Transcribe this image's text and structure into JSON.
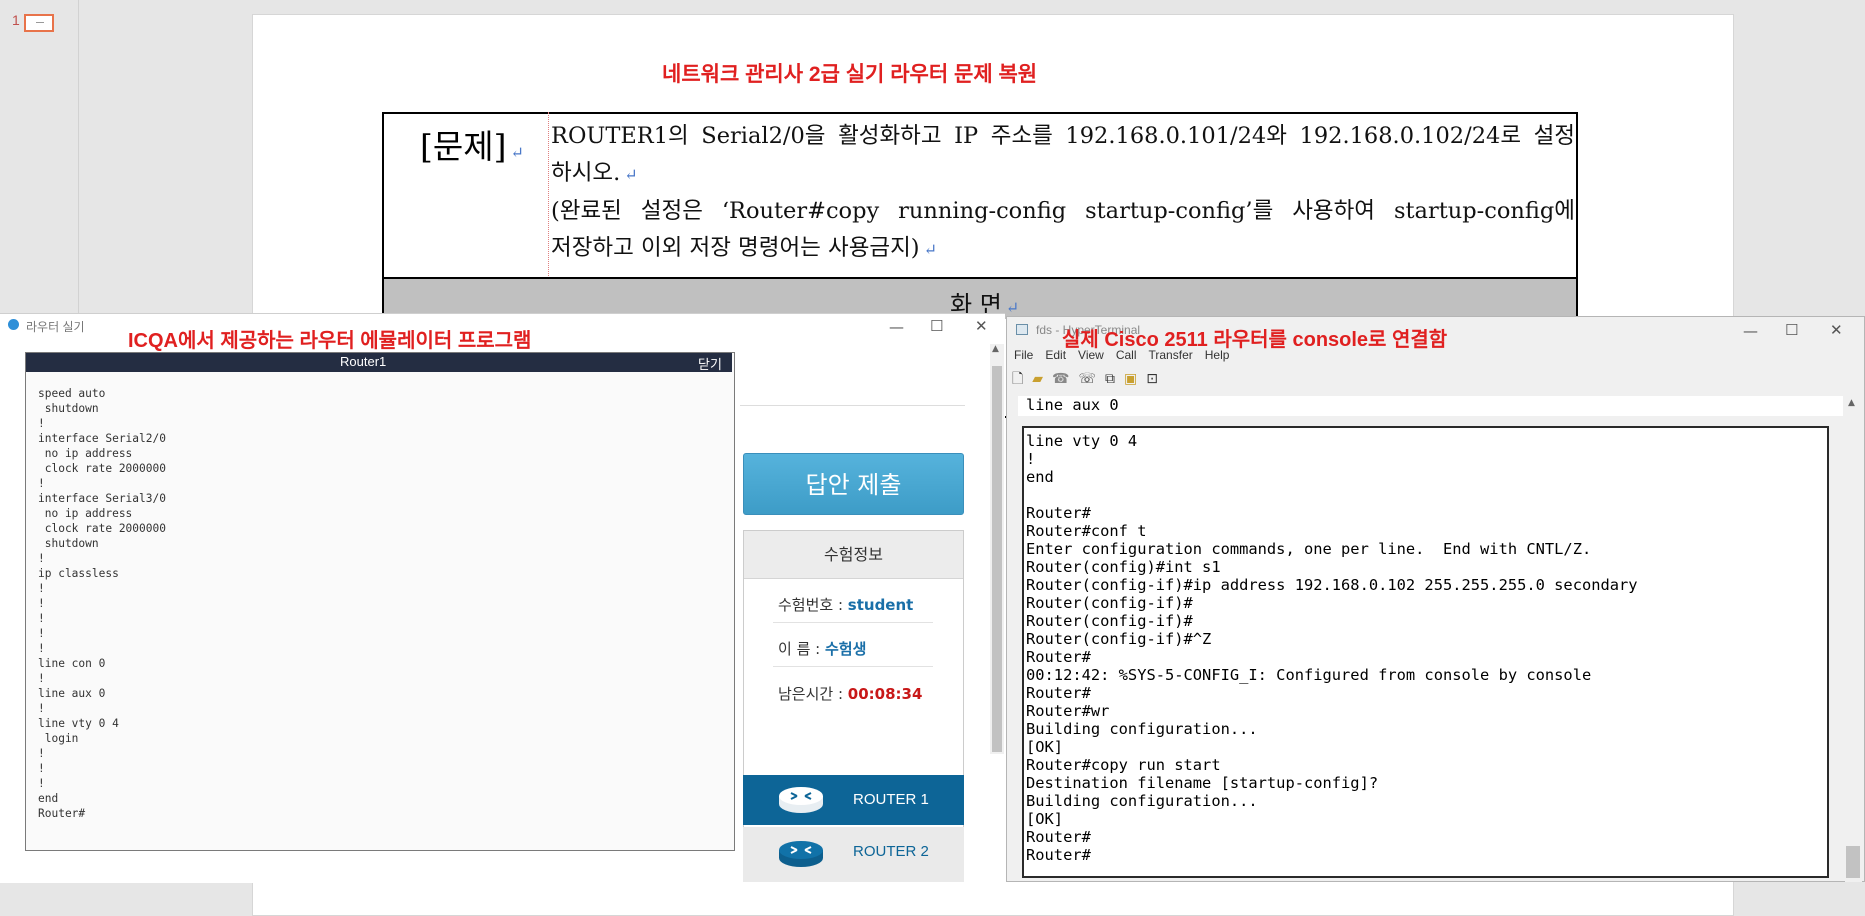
{
  "slide_panel": {
    "slide_number": "1"
  },
  "slide": {
    "title": "네트워크 관리사 2급 실기 라우터 문제 복원",
    "problem_label": "[문제]",
    "problem_lines": [
      "ROUTER1의 Serial2/0을 활성화하고 IP 주소를 192.168.0.101/24와 192.168.0.102/24로 설정",
      "하시오.",
      "(완료된 설정은 ‘Router#copy running-config startup-config’를 사용하여 startup-config에",
      "저장하고 이외 저장 명령어는 사용금지)"
    ],
    "paragraph_mark": "↵",
    "screen_label": "화 면"
  },
  "emulator": {
    "window_title": "라우터 실기",
    "window_controls": [
      "—",
      "☐",
      "✕"
    ],
    "caption": "ICQA에서 제공하는 라우터 에뮬레이터 프로그램",
    "terminal_title": "Router1",
    "terminal_close": "닫기",
    "terminal_text": "speed auto\n shutdown\n!\ninterface Serial2/0\n no ip address\n clock rate 2000000\n!\ninterface Serial3/0\n no ip address\n clock rate 2000000\n shutdown\n!\nip classless\n!\n!\n!\n!\n!\nline con 0\n!\nline aux 0\n!\nline vty 0 4\n login\n!\n!\n!\nend\nRouter#",
    "submit_label": "답안 제출",
    "info": {
      "header": "수험정보",
      "exam_no_label": "수험번호 : ",
      "exam_no_value": "student",
      "name_label": "이 름 : ",
      "name_value": "수험생",
      "time_label": "남은시간 : ",
      "time_value": "00:08:34"
    },
    "routers": [
      {
        "label": "ROUTER 1",
        "active": true
      },
      {
        "label": "ROUTER 2",
        "active": false
      }
    ]
  },
  "cisco_terminal": {
    "window_title": "fds - HyperTerminal",
    "caption": "실제 Cisco 2511 라우터를 console로 연결함",
    "window_controls": [
      "—",
      "☐",
      "✕"
    ],
    "menu": [
      "File",
      "Edit",
      "View",
      "Call",
      "Transfer",
      "Help"
    ],
    "toolbar_icons": [
      "new-icon",
      "open-icon",
      "disconnect-icon",
      "dial-icon",
      "send-icon",
      "receive-icon",
      "properties-icon"
    ],
    "top_line": "line aux 0",
    "text": "line vty 0 4\n!\nend\n\nRouter#\nRouter#conf t\nEnter configuration commands, one per line.  End with CNTL/Z.\nRouter(config)#int s1\nRouter(config-if)#ip address 192.168.0.102 255.255.255.0 secondary\nRouter(config-if)#\nRouter(config-if)#\nRouter(config-if)#^Z\nRouter#\n00:12:42: %SYS-5-CONFIG_I: Configured from console by console\nRouter#\nRouter#wr\nBuilding configuration...\n[OK]\nRouter#copy run start\nDestination filename [startup-config]?\nBuilding configuration...\n[OK]\nRouter#\nRouter#"
  }
}
